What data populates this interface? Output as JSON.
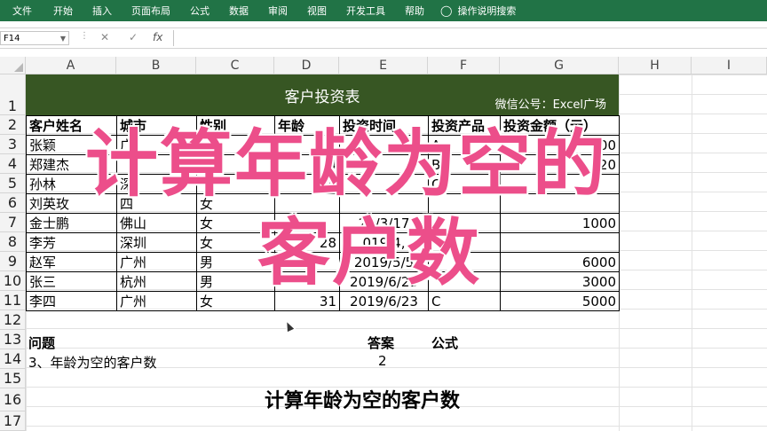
{
  "ribbon": {
    "tabs": [
      "文件",
      "开始",
      "插入",
      "页面布局",
      "公式",
      "数据",
      "审阅",
      "视图",
      "开发工具",
      "帮助"
    ],
    "tell_me": "操作说明搜索"
  },
  "formula_bar": {
    "name_box": "F14",
    "cancel": "✕",
    "enter": "✓",
    "fx": "fx"
  },
  "columns": [
    "A",
    "B",
    "C",
    "D",
    "E",
    "F",
    "G",
    "H",
    "I"
  ],
  "rows": [
    "1",
    "2",
    "3",
    "4",
    "5",
    "6",
    "7",
    "8",
    "9",
    "10",
    "11",
    "12",
    "13",
    "14",
    "15",
    "16",
    "17"
  ],
  "title": {
    "text": "客户投资表",
    "wechat": "微信公号：Excel广场"
  },
  "table": {
    "headers": [
      "客户姓名",
      "城市",
      "性别",
      "年龄",
      "投资时间",
      "投资产品",
      "投资金额（元）"
    ],
    "rows": [
      [
        "张颖",
        "广",
        "",
        "",
        "",
        "A",
        "00"
      ],
      [
        "郑建杰",
        "",
        "",
        "4",
        "",
        "B",
        "20"
      ],
      [
        "孙林",
        "深",
        "",
        "35",
        "",
        "C",
        ""
      ],
      [
        "刘英玫",
        "四",
        "女",
        "",
        "",
        "",
        ""
      ],
      [
        "金士鹏",
        "佛山",
        "女",
        "",
        "20/3/17",
        "",
        "1000"
      ],
      [
        "李芳",
        "深圳",
        "女",
        "28",
        "019/4,",
        "",
        ""
      ],
      [
        "赵军",
        "广州",
        "男",
        "",
        "2019/5/5",
        "",
        "6000"
      ],
      [
        "张三",
        "杭州",
        "男",
        "",
        "2019/6/23",
        "",
        "3000"
      ],
      [
        "李四",
        "广州",
        "女",
        "31",
        "2019/6/23",
        "C",
        "5000"
      ]
    ]
  },
  "question": {
    "label": "问题",
    "answer_label": "答案",
    "formula_label": "公式",
    "text": "3、年龄为空的客户数",
    "answer": "2"
  },
  "caption": "计算年龄为空的客户数",
  "overlay": {
    "line1": "计算年龄为空的",
    "line2": "客户数"
  },
  "colors": {
    "ribbon": "#217346",
    "title_bg": "#375623",
    "overlay": "#ec4e8a"
  }
}
